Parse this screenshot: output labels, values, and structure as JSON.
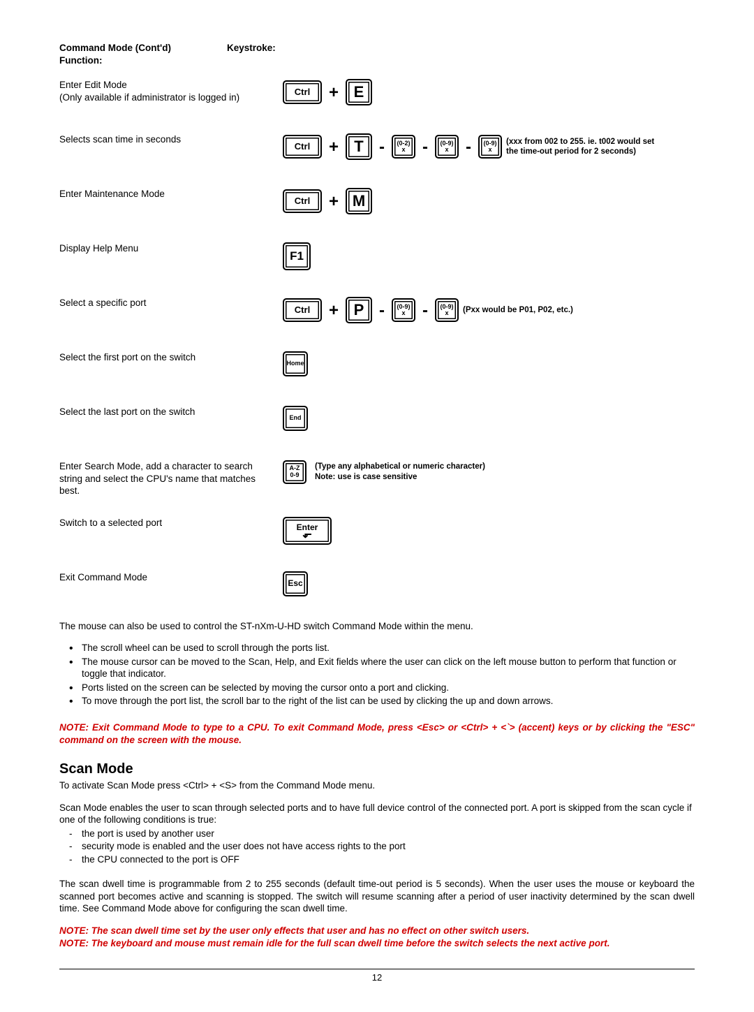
{
  "headers": {
    "title": "Command Mode (Cont'd)",
    "func": "Function:",
    "key": "Keystroke:"
  },
  "rows": {
    "editmode": {
      "func": "Enter Edit Mode",
      "sub": "(Only available if administrator is logged in)"
    },
    "scantime": {
      "func": "Selects scan time in seconds",
      "note": "(xxx from 002 to 255.   ie.  t002 would set the time-out period for 2 seconds)"
    },
    "maint": {
      "func": "Enter Maintenance Mode"
    },
    "help": {
      "func": "Display Help Menu"
    },
    "selport": {
      "func": "Select a specific port",
      "note": "(Pxx would be P01, P02, etc.)"
    },
    "first": {
      "func": "Select the first port on the switch"
    },
    "last": {
      "func": "Select the last port on the switch"
    },
    "search": {
      "func": "Enter Search Mode, add a character to search string and select the CPU's name that matches best.",
      "note1": "(Type any alphabetical or numeric character)",
      "note2": "    Note:  use is case sensitive"
    },
    "switch": {
      "func": "Switch to a selected port"
    },
    "exit": {
      "func": "Exit Command Mode"
    }
  },
  "keys": {
    "ctrl": "Ctrl",
    "E": "E",
    "T": "T",
    "M": "M",
    "P": "P",
    "F1": "F1",
    "home": "Home",
    "end": "End",
    "enter": "Enter",
    "esc": "Esc",
    "r02": "(0-2)",
    "r09": "(0-9)",
    "x": "x",
    "az": "A-Z",
    "n09": "0-9"
  },
  "mouse_intro": "The mouse can also be used to control the ST-nXm-U-HD switch Command Mode within the menu.",
  "bullets": [
    "The scroll wheel can be used to scroll through the ports list.",
    "The mouse cursor can be moved to the Scan, Help, and Exit fields where the user can click on the left mouse button to perform that function or toggle that indicator.",
    "Ports listed on the screen can be selected by moving the cursor onto a port and clicking.",
    "To move through the port list, the scroll bar to the right of the list can be used by clicking the up and down arrows."
  ],
  "note1": "NOTE: Exit Command Mode to type to a CPU.  To exit Command Mode, press <Esc> or  <Ctrl> + <`> (accent) keys or by clicking the \"ESC\" command on the screen with the mouse.",
  "scan": {
    "title": "Scan Mode",
    "p1": "To activate Scan Mode press <Ctrl> + <S> from the Command Mode menu.",
    "p2": "Scan Mode enables the user to scan through selected ports and to have full device control of the connected port. A port is skipped from the scan cycle if one of the following conditions is true:",
    "dashes": [
      "the port is used by another user",
      "security mode is enabled and the user does not have access rights to the port",
      "the CPU connected to the port is OFF"
    ],
    "p3": "The scan dwell time is programmable from 2 to 255 seconds (default time-out period is 5 seconds). When the user uses the mouse or keyboard the scanned port becomes active and scanning is stopped. The switch will resume scanning after a period of user inactivity determined by the scan dwell time.  See Command Mode above for configuring the scan dwell time.",
    "note2a": "NOTE:  The scan dwell time set by the user only effects that user and has no effect on other switch users.",
    "note2b": "NOTE: The keyboard and mouse must remain idle for the full scan dwell time before the switch selects the next active port."
  },
  "pagenum": "12"
}
